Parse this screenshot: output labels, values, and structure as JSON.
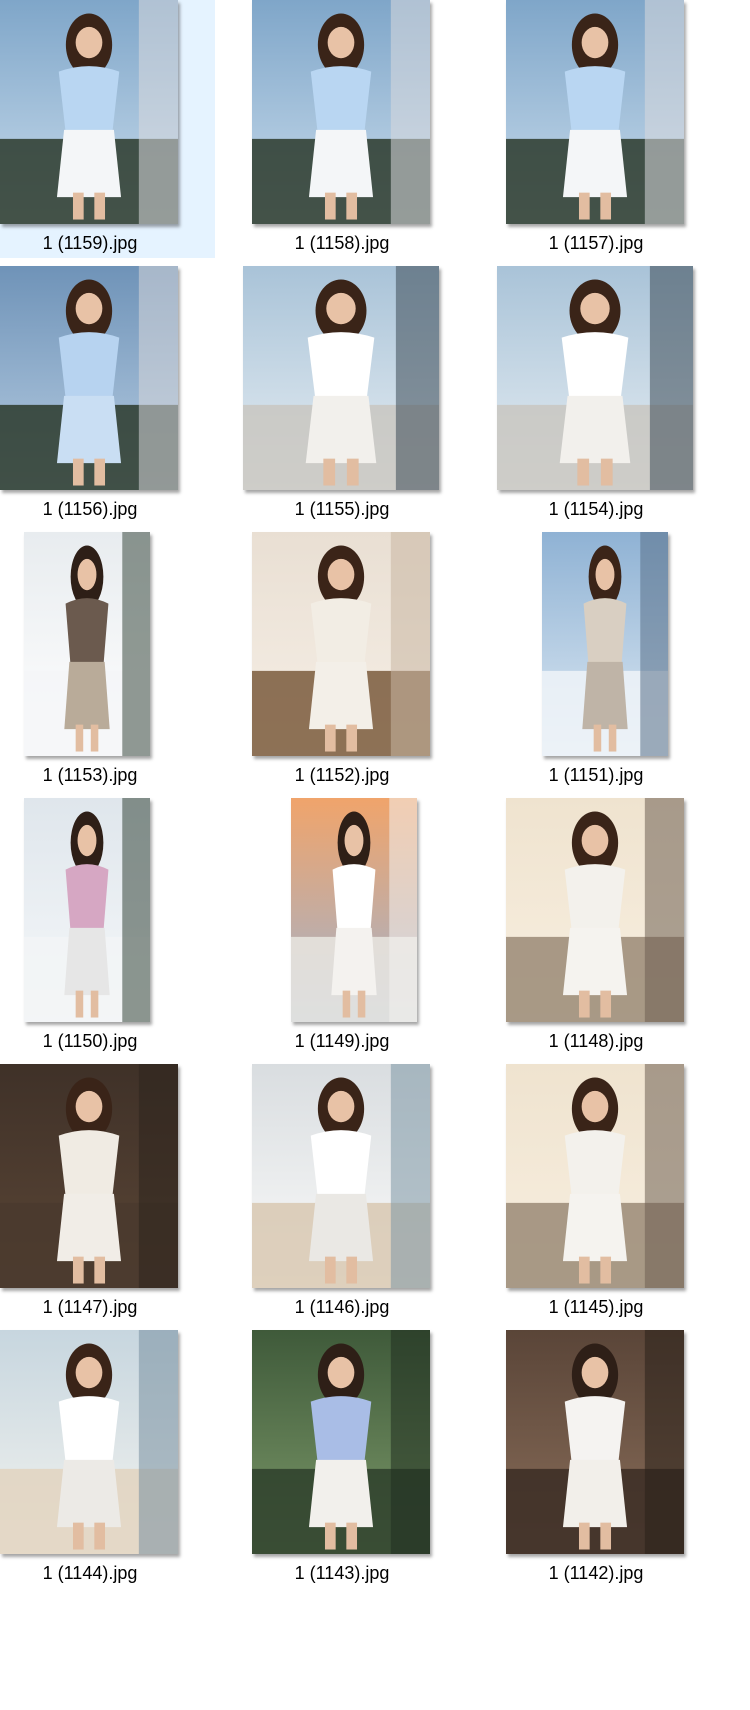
{
  "files": [
    {
      "name": "1 (1159).jpg",
      "selected": true,
      "orientation": "portrait",
      "scene": "balcony-sportswear"
    },
    {
      "name": "1 (1158).jpg",
      "selected": false,
      "orientation": "portrait",
      "scene": "balcony-sportswear"
    },
    {
      "name": "1 (1157).jpg",
      "selected": false,
      "orientation": "portrait",
      "scene": "balcony-sportswear"
    },
    {
      "name": "1 (1156).jpg",
      "selected": false,
      "orientation": "portrait",
      "scene": "balcony-closeup"
    },
    {
      "name": "1 (1155).jpg",
      "selected": false,
      "orientation": "portrait",
      "scene": "glass-building"
    },
    {
      "name": "1 (1154).jpg",
      "selected": false,
      "orientation": "portrait",
      "scene": "glass-building"
    },
    {
      "name": "1 (1153).jpg",
      "selected": false,
      "orientation": "narrow",
      "scene": "snow-train"
    },
    {
      "name": "1 (1152).jpg",
      "selected": false,
      "orientation": "portrait",
      "scene": "indoor-selfie"
    },
    {
      "name": "1 (1151).jpg",
      "selected": false,
      "orientation": "narrow",
      "scene": "snow-sunglasses"
    },
    {
      "name": "1 (1150).jpg",
      "selected": false,
      "orientation": "narrow",
      "scene": "snow-forest"
    },
    {
      "name": "1 (1149).jpg",
      "selected": false,
      "orientation": "narrow",
      "scene": "sunset-arch"
    },
    {
      "name": "1 (1148).jpg",
      "selected": false,
      "orientation": "portrait",
      "scene": "rocks-lying"
    },
    {
      "name": "1 (1147).jpg",
      "selected": false,
      "orientation": "portrait",
      "scene": "rocks-dark"
    },
    {
      "name": "1 (1146).jpg",
      "selected": false,
      "orientation": "portrait",
      "scene": "beach-sun"
    },
    {
      "name": "1 (1145).jpg",
      "selected": false,
      "orientation": "portrait",
      "scene": "rocks-lying"
    },
    {
      "name": "1 (1144).jpg",
      "selected": false,
      "orientation": "portrait",
      "scene": "beach-pose"
    },
    {
      "name": "1 (1143).jpg",
      "selected": false,
      "orientation": "portrait",
      "scene": "couple-garden"
    },
    {
      "name": "1 (1142).jpg",
      "selected": false,
      "orientation": "portrait",
      "scene": "bride-veil"
    }
  ],
  "colors": {
    "selection": "#e5f3ff",
    "text": "#000000"
  }
}
